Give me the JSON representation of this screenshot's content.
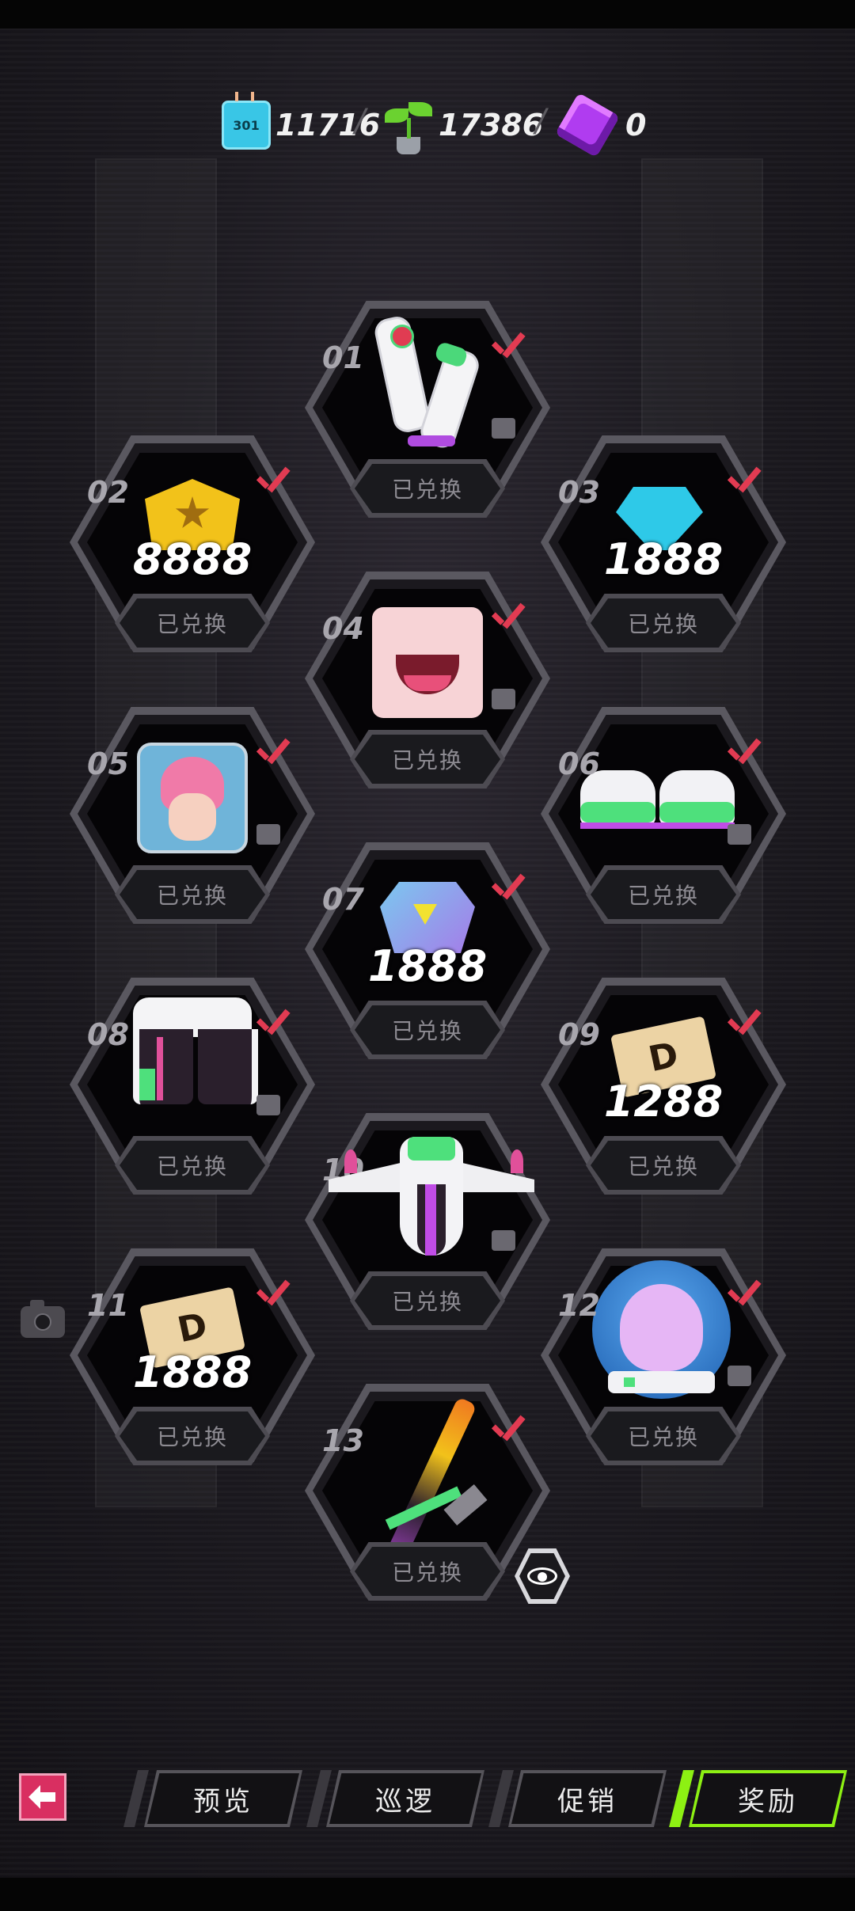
{
  "currencies": [
    {
      "icon": "chip-icon",
      "chip_text": "301",
      "value": "11716"
    },
    {
      "icon": "sprout-icon",
      "value": "17386"
    },
    {
      "icon": "purple-cube-icon",
      "value": "0"
    }
  ],
  "separator": "/",
  "rewards": [
    {
      "number": "01",
      "item": "gloves",
      "amount": "",
      "status": "已兑换",
      "redeemed": true
    },
    {
      "number": "02",
      "item": "gold-badge",
      "amount": "8888",
      "status": "已兑换",
      "redeemed": true
    },
    {
      "number": "03",
      "item": "blue-gem",
      "amount": "1888",
      "status": "已兑换",
      "redeemed": true
    },
    {
      "number": "04",
      "item": "face-mouth",
      "amount": "",
      "status": "已兑换",
      "redeemed": true
    },
    {
      "number": "05",
      "item": "avatar-portrait",
      "amount": "",
      "status": "已兑换",
      "redeemed": true
    },
    {
      "number": "06",
      "item": "shoes",
      "amount": "",
      "status": "已兑换",
      "redeemed": true
    },
    {
      "number": "07",
      "item": "purple-token",
      "amount": "1888",
      "status": "已兑换",
      "redeemed": true
    },
    {
      "number": "08",
      "item": "pants",
      "amount": "",
      "status": "已兑换",
      "redeemed": true
    },
    {
      "number": "09",
      "item": "d-ticket",
      "amount": "1288",
      "status": "已兑换",
      "redeemed": true
    },
    {
      "number": "10",
      "item": "suit-top",
      "amount": "",
      "status": "已兑换",
      "redeemed": true
    },
    {
      "number": "11",
      "item": "d-ticket",
      "amount": "1888",
      "status": "已兑换",
      "redeemed": true
    },
    {
      "number": "12",
      "item": "hair-helmet",
      "amount": "",
      "status": "已兑换",
      "redeemed": true
    },
    {
      "number": "13",
      "item": "weapon",
      "amount": "",
      "status": "已兑换",
      "redeemed": true
    }
  ],
  "nav": {
    "back_icon": "back-arrow-icon",
    "tabs": [
      {
        "label": "预览",
        "active": false
      },
      {
        "label": "巡逻",
        "active": false
      },
      {
        "label": "促销",
        "active": false
      },
      {
        "label": "奖励",
        "active": true
      }
    ]
  },
  "colors": {
    "accent_green": "#8df013",
    "check_red": "#e23b52",
    "back_button": "#d92f61"
  }
}
